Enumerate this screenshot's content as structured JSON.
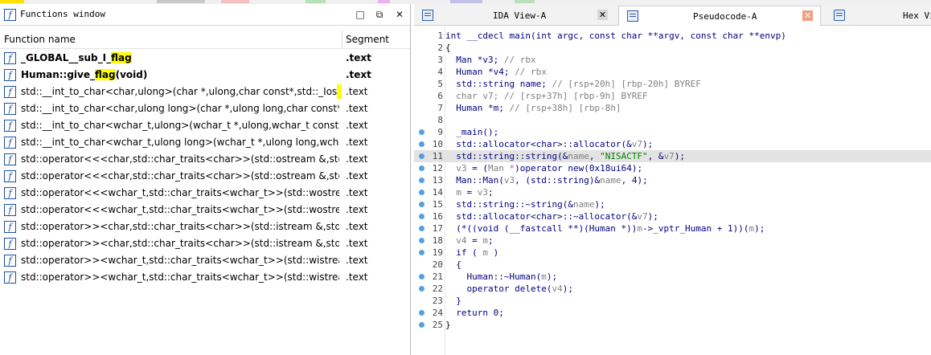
{
  "functions_window": {
    "title": "Functions window",
    "controls": {
      "dock": "□",
      "float": "⧉",
      "close": "✕"
    },
    "columns": {
      "name": "Function name",
      "segment": "Segment"
    },
    "rows": [
      {
        "pre": "_GLOBAL__sub_I_",
        "hl": "flag",
        "post": "",
        "segment": ".text",
        "bold": true
      },
      {
        "pre": "Human::give_",
        "hl": "flag",
        "post": "(void)",
        "segment": ".text",
        "bold": true
      },
      {
        "pre": "std::__int_to_char<char,ulong>(char *,ulong,char const*,std::_Ios_F...",
        "hl": "",
        "post": "",
        "segment": ".text",
        "mark": true
      },
      {
        "pre": "std::__int_to_char<char,ulong long>(char *,ulong long,char const*,s...",
        "hl": "",
        "post": "",
        "segment": ".text"
      },
      {
        "pre": "std::__int_to_char<wchar_t,ulong>(wchar_t *,ulong,wchar_t const*,st...",
        "hl": "",
        "post": "",
        "segment": ".text"
      },
      {
        "pre": "std::__int_to_char<wchar_t,ulong long>(wchar_t *,ulong long,wchar_...",
        "hl": "",
        "post": "",
        "segment": ".text"
      },
      {
        "pre": "std::operator<<<char,std::char_traits<char>>(std::ostream &,std::...",
        "hl": "",
        "post": "",
        "segment": ".text"
      },
      {
        "pre": "std::operator<<<char,std::char_traits<char>>(std::ostream &,std::...",
        "hl": "",
        "post": "",
        "segment": ".text"
      },
      {
        "pre": "std::operator<<<wchar_t,std::char_traits<wchar_t>>(std::wostrea...",
        "hl": "",
        "post": "",
        "segment": ".text"
      },
      {
        "pre": "std::operator<<<wchar_t,std::char_traits<wchar_t>>(std::wostrea...",
        "hl": "",
        "post": "",
        "segment": ".text"
      },
      {
        "pre": "std::operator>><char,std::char_traits<char>>(std::istream &,std::...",
        "hl": "",
        "post": "",
        "segment": ".text"
      },
      {
        "pre": "std::operator>><char,std::char_traits<char>>(std::istream &,std::...",
        "hl": "",
        "post": "",
        "segment": ".text"
      },
      {
        "pre": "std::operator>><wchar_t,std::char_traits<wchar_t>>(std::wistream ...",
        "hl": "",
        "post": "",
        "segment": ".text"
      },
      {
        "pre": "std::operator>><wchar_t,std::char_traits<wchar_t>>(std::wistream ...",
        "hl": "",
        "post": "",
        "segment": ".text"
      }
    ]
  },
  "tabs": [
    {
      "label": "IDA View-A",
      "close": "✕",
      "active": false
    },
    {
      "label": "Pseudocode-A",
      "close": "✕",
      "active": true
    },
    {
      "label": "Hex Vi",
      "close": "",
      "active": false
    }
  ],
  "code": {
    "selected_line": 11,
    "lines": [
      {
        "n": "1",
        "dot": false,
        "parts": [
          [
            "k",
            "int __cdecl main(int argc, const char **argv, const char **envp)"
          ]
        ]
      },
      {
        "n": "2",
        "dot": false,
        "parts": [
          [
            "",
            "{"
          ]
        ]
      },
      {
        "n": "3",
        "dot": false,
        "parts": [
          [
            "k",
            "  Man *v3; "
          ],
          [
            "c",
            "// rbx"
          ]
        ]
      },
      {
        "n": "4",
        "dot": false,
        "parts": [
          [
            "k",
            "  Human *v4; "
          ],
          [
            "c",
            "// rbx"
          ]
        ]
      },
      {
        "n": "5",
        "dot": false,
        "parts": [
          [
            "k",
            "  std::string name; "
          ],
          [
            "c",
            "// [rsp+20h] [rbp-20h] BYREF"
          ]
        ]
      },
      {
        "n": "6",
        "dot": false,
        "parts": [
          [
            "c",
            "  char v7; // [rsp+37h] [rbp-9h] BYREF"
          ]
        ]
      },
      {
        "n": "7",
        "dot": false,
        "parts": [
          [
            "k",
            "  Human *m; "
          ],
          [
            "c",
            "// [rsp+38h] [rbp-8h]"
          ]
        ]
      },
      {
        "n": "8",
        "dot": false,
        "parts": [
          [
            "",
            ""
          ]
        ]
      },
      {
        "n": "9",
        "dot": true,
        "parts": [
          [
            "k",
            "  _main();"
          ]
        ]
      },
      {
        "n": "10",
        "dot": true,
        "parts": [
          [
            "k",
            "  std::allocator<char>::allocator(&"
          ],
          [
            "c",
            "v7"
          ],
          [
            "k",
            ");"
          ]
        ]
      },
      {
        "n": "11",
        "dot": true,
        "parts": [
          [
            "k",
            "  std::string::string(&"
          ],
          [
            "c",
            "name"
          ],
          [
            "k",
            ", "
          ],
          [
            "s",
            "\"NISACTF\""
          ],
          [
            "k",
            ", &"
          ],
          [
            "c",
            "v7"
          ],
          [
            "k",
            ");"
          ]
        ]
      },
      {
        "n": "12",
        "dot": true,
        "parts": [
          [
            "c",
            "  v3"
          ],
          [
            "k",
            " = ("
          ],
          [
            "c",
            "Man *"
          ],
          [
            "k",
            ")operator new(0x18ui64);"
          ]
        ]
      },
      {
        "n": "13",
        "dot": true,
        "parts": [
          [
            "k",
            "  Man::Man("
          ],
          [
            "c",
            "v3"
          ],
          [
            "k",
            ", (std::string)&"
          ],
          [
            "c",
            "name"
          ],
          [
            "k",
            ", 4);"
          ]
        ]
      },
      {
        "n": "14",
        "dot": true,
        "parts": [
          [
            "c",
            "  m"
          ],
          [
            "k",
            " = "
          ],
          [
            "c",
            "v3"
          ],
          [
            "k",
            ";"
          ]
        ]
      },
      {
        "n": "15",
        "dot": true,
        "parts": [
          [
            "k",
            "  std::string::~string(&"
          ],
          [
            "c",
            "name"
          ],
          [
            "k",
            ");"
          ]
        ]
      },
      {
        "n": "16",
        "dot": true,
        "parts": [
          [
            "k",
            "  std::allocator<char>::~allocator(&"
          ],
          [
            "c",
            "v7"
          ],
          [
            "k",
            ");"
          ]
        ]
      },
      {
        "n": "17",
        "dot": true,
        "parts": [
          [
            "k",
            "  (*((void (__fastcall **)(Human *))"
          ],
          [
            "c",
            "m"
          ],
          [
            "k",
            "->_vptr_Human + 1))("
          ],
          [
            "c",
            "m"
          ],
          [
            "k",
            ");"
          ]
        ]
      },
      {
        "n": "18",
        "dot": true,
        "parts": [
          [
            "c",
            "  v4"
          ],
          [
            "k",
            " = "
          ],
          [
            "c",
            "m"
          ],
          [
            "k",
            ";"
          ]
        ]
      },
      {
        "n": "19",
        "dot": true,
        "parts": [
          [
            "k",
            "  if ( "
          ],
          [
            "c",
            "m"
          ],
          [
            "k",
            " )"
          ]
        ]
      },
      {
        "n": "20",
        "dot": false,
        "parts": [
          [
            "k",
            "  {"
          ]
        ]
      },
      {
        "n": "21",
        "dot": true,
        "parts": [
          [
            "k",
            "    Human::~Human("
          ],
          [
            "c",
            "m"
          ],
          [
            "k",
            ");"
          ]
        ]
      },
      {
        "n": "22",
        "dot": true,
        "parts": [
          [
            "k",
            "    operator delete("
          ],
          [
            "c",
            "v4"
          ],
          [
            "k",
            ");"
          ]
        ]
      },
      {
        "n": "23",
        "dot": false,
        "parts": [
          [
            "k",
            "  }"
          ]
        ]
      },
      {
        "n": "24",
        "dot": true,
        "parts": [
          [
            "k",
            "  return 0;"
          ]
        ]
      },
      {
        "n": "25",
        "dot": true,
        "parts": [
          [
            "",
            "}"
          ]
        ]
      }
    ]
  },
  "colors": {
    "keyword": "#000080",
    "comment": "#808080",
    "string": "#008000",
    "highlight": "#ffff00",
    "selection": "#e3e3e3",
    "breakpoint_dot": "#55a0e0",
    "function_icon": "#1a4fa0",
    "close_tab_bg": "#f0a080"
  }
}
